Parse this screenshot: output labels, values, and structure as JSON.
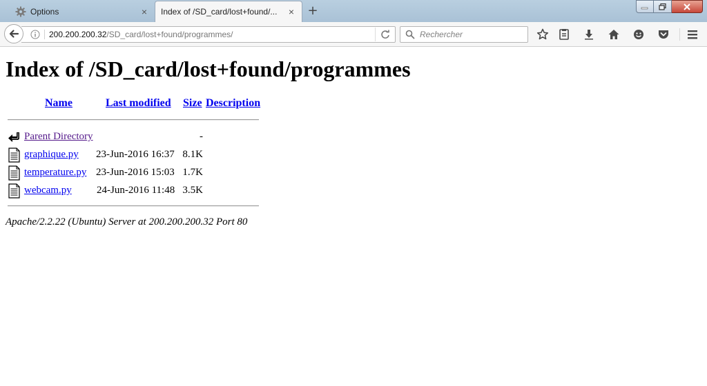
{
  "browser": {
    "tabs": [
      {
        "label": "Options",
        "icon": "gear-icon",
        "active": false
      },
      {
        "label": "Index of /SD_card/lost+found/...",
        "icon": "none",
        "active": true
      }
    ],
    "new_tab_label": "+",
    "close_label": "×",
    "url": {
      "host": "200.200.200.32",
      "path": "/SD_card/lost+found/programmes/"
    },
    "search": {
      "placeholder": "Rechercher"
    },
    "toolbar_icons": [
      "star-icon",
      "reading-list-icon",
      "download-icon",
      "home-icon",
      "smiley-icon",
      "pocket-icon",
      "menu-icon"
    ]
  },
  "page": {
    "title": "Index of /SD_card/lost+found/programmes",
    "columns": {
      "name": "Name",
      "last_modified": "Last modified",
      "size": "Size",
      "description": "Description"
    },
    "rows": [
      {
        "icon": "parent-directory-icon",
        "name": "Parent Directory",
        "modified": "",
        "size": "-",
        "visited": true
      },
      {
        "icon": "file-icon",
        "name": "graphique.py",
        "modified": "23-Jun-2016 16:37",
        "size": "8.1K",
        "visited": false
      },
      {
        "icon": "file-icon",
        "name": "temperature.py",
        "modified": "23-Jun-2016 15:03",
        "size": "1.7K",
        "visited": false
      },
      {
        "icon": "file-icon",
        "name": "webcam.py",
        "modified": "24-Jun-2016 11:48",
        "size": "3.5K",
        "visited": false
      }
    ],
    "server_signature": "Apache/2.2.22 (Ubuntu) Server at 200.200.200.32 Port 80"
  },
  "colors": {
    "link": "#0000ee",
    "visited_link": "#551a8b",
    "titlebar": "#b9cfe0",
    "close_button": "#c7483a"
  }
}
